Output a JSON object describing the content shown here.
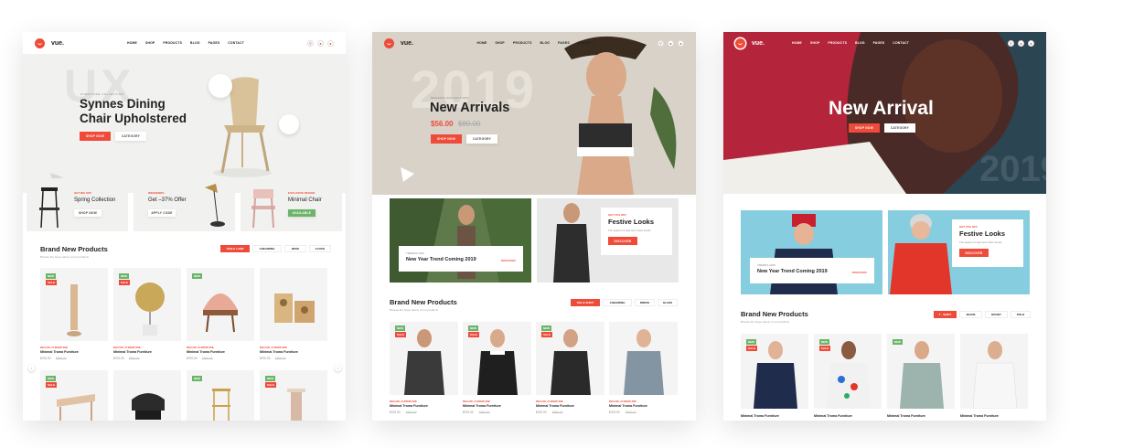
{
  "colors": {
    "accent": "#ef4b3a",
    "green": "#6db46b"
  },
  "nav": {
    "brand": "vue.",
    "menu": [
      "HOME",
      "SHOP",
      "PRODUCTS",
      "BLOG",
      "PAGES",
      "CONTACT"
    ]
  },
  "panel1": {
    "hero": {
      "bg_text": "UX",
      "label": "FURNITURE COLLECTION",
      "title_line1": "Synnes Dining",
      "title_line2": "Chair Upholstered",
      "btn_shop": "SHOP NOW",
      "btn_category": "CATEGORY"
    },
    "promos": [
      {
        "label": "GET BIG OFF",
        "title": "Spring Collection",
        "button": "SHOP NOW"
      },
      {
        "label": "WEEKENDS",
        "title": "Get –37% Offer",
        "button": "APPLY CODE"
      },
      {
        "label": "EXCLUSIVE DESIGN",
        "title": "Minimal Chair",
        "button": "AVAILABLE"
      }
    ],
    "section": {
      "title": "Brand New Products",
      "subtitle": "Browse the huge variety of our products",
      "filters": [
        "TABLE LAMP",
        "CHEAIRING",
        "DESK",
        "CLOCK"
      ]
    },
    "products": [
      {
        "tags": [
          "NEW",
          "SALE"
        ],
        "category": "DECOR, FURNITURE",
        "name": "Minimal Troma Furniture",
        "price": "$700.00",
        "old": "$900.00"
      },
      {
        "tags": [
          "NEW",
          "SALE"
        ],
        "category": "DECOR, FURNITURE",
        "name": "Minimal Troma Furniture",
        "price": "$700.00",
        "old": "$900.00"
      },
      {
        "tags": [
          "NEW"
        ],
        "category": "DECOR, FURNITURE",
        "name": "Minimal Troma Furniture",
        "price": "$700.00",
        "old": "$900.00"
      },
      {
        "tags": [],
        "category": "DECOR, FURNITURE",
        "name": "Minimal Troma Furniture",
        "price": "$700.00",
        "old": "$900.00"
      },
      {
        "tags": [
          "NEW",
          "SALE"
        ]
      },
      {
        "tags": []
      },
      {
        "tags": [
          "NEW"
        ]
      },
      {
        "tags": [
          "NEW",
          "SALE"
        ]
      }
    ]
  },
  "panel2": {
    "hero": {
      "bg_text": "2019",
      "label": "SEASON COLLECTION",
      "title": "New Arrivals",
      "price": "$56.00",
      "old_price": "$89.00",
      "btn_shop": "SHOP NOW",
      "btn_category": "CATEGORY"
    },
    "banner1": {
      "label": "TRENDS 2019",
      "title": "New Year Trend Coming 2019",
      "link": "DISCOVER"
    },
    "banner2": {
      "label": "GET 15% OFF",
      "title": "Festive Looks",
      "desc": "The season of style and colors trends",
      "button": "DISCOVER"
    },
    "section": {
      "title": "Brand New Products",
      "subtitle": "Browse the huge variety of our products",
      "filters": [
        "TEE & SHIRT",
        "CHEAIRING",
        "DRESS",
        "GLASS"
      ]
    },
    "products": [
      {
        "tags": [
          "NEW",
          "SALE"
        ],
        "category": "DECOR, FURNITURE",
        "name": "Minimal Troma Furniture",
        "price": "$700.00",
        "old": "$900.00"
      },
      {
        "tags": [
          "NEW",
          "SALE"
        ],
        "category": "DECOR, FURNITURE",
        "name": "Minimal Troma Furniture",
        "price": "$700.00",
        "old": "$900.00"
      },
      {
        "tags": [
          "NEW",
          "SALE"
        ],
        "category": "DECOR, FURNITURE",
        "name": "Minimal Troma Furniture",
        "price": "$700.00",
        "old": "$900.00"
      },
      {
        "tags": [],
        "category": "DECOR, FURNITURE",
        "name": "Minimal Troma Furniture",
        "price": "$700.00",
        "old": "$900.00"
      }
    ]
  },
  "panel3": {
    "hero": {
      "title": "New Arrival",
      "bg_text": "2019",
      "btn_shop": "SHOP NOW",
      "btn_category": "CATEGORY"
    },
    "banner1": {
      "label": "TRENDS 2019",
      "title": "New Year Trend Coming 2019",
      "link": "DISCOVER"
    },
    "banner2": {
      "label": "GET 15% OFF",
      "title": "Festive Looks",
      "desc": "The season of style and colors trends",
      "button": "DISCOVER"
    },
    "section": {
      "title": "Brand New Products",
      "subtitle": "Browse the huge variety of our products",
      "filters": [
        "T - SHIRT",
        "JEANS",
        "HOODY",
        "POLO"
      ]
    },
    "products": [
      {
        "tags": [
          "NEW",
          "SALE"
        ],
        "name": "Minimal Troma Furniture"
      },
      {
        "tags": [
          "NEW",
          "SALE"
        ],
        "name": "Minimal Troma Furniture"
      },
      {
        "tags": [
          "NEW"
        ],
        "name": "Minimal Troma Furniture"
      },
      {
        "tags": [],
        "name": "Minimal Troma Furniture"
      }
    ]
  }
}
